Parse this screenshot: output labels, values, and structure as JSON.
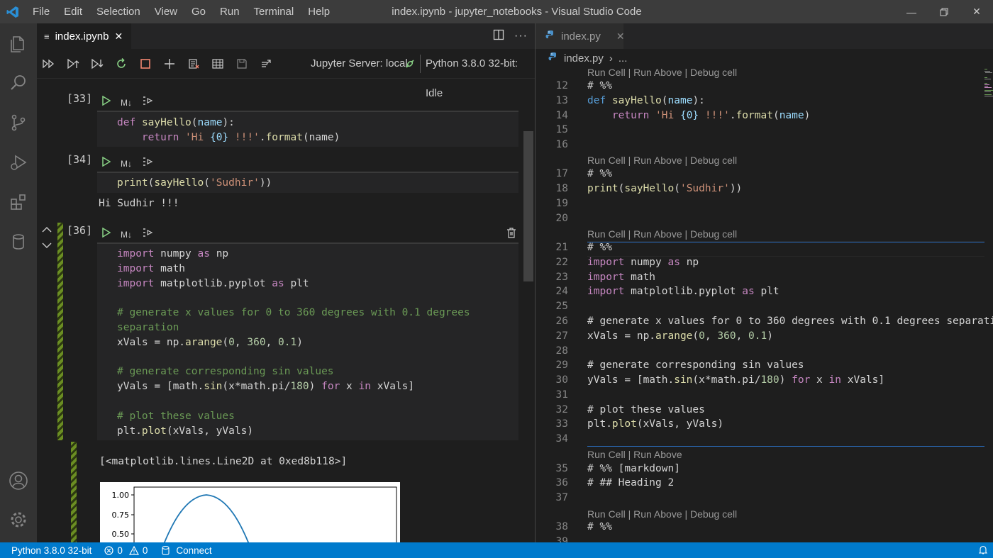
{
  "window": {
    "title": "index.ipynb - jupyter_notebooks - Visual Studio Code",
    "menu": [
      "File",
      "Edit",
      "Selection",
      "View",
      "Go",
      "Run",
      "Terminal",
      "Help"
    ]
  },
  "left_editor": {
    "tab_label": "index.ipynb",
    "jupyter_server": "Jupyter Server: local",
    "kernel": "Python 3.8.0 32-bit: Idle",
    "cell_toolbar_md": "M↓",
    "cells": [
      {
        "prompt": "[33]",
        "code": [
          "def sayHello(name):",
          "    return 'Hi {0} !!!'.format(name)"
        ]
      },
      {
        "prompt": "[34]",
        "code": [
          "print(sayHello('Sudhir'))"
        ],
        "output": "Hi Sudhir !!!"
      },
      {
        "prompt": "[36]",
        "code": [
          "import numpy as np",
          "import math",
          "import matplotlib.pyplot as plt",
          "",
          "# generate x values for 0 to 360 degrees with 0.1 degrees",
          "separation",
          "xVals = np.arange(0, 360, 0.1)",
          "",
          "# generate corresponding sin values",
          "yVals = [math.sin(x*math.pi/180) for x in xVals]",
          "",
          "# plot these values",
          "plt.plot(xVals, yVals)"
        ],
        "output": "[<matplotlib.lines.Line2D at 0xed8b118>]"
      }
    ],
    "plot": {
      "yticks": [
        "1.00",
        "0.75",
        "0.50"
      ],
      "line_color": "#1f77b4"
    }
  },
  "right_editor": {
    "tab_label": "index.py",
    "breadcrumb_file": "index.py",
    "breadcrumb_more": "...",
    "lines": [
      {
        "n": "12",
        "t": "# %%"
      },
      {
        "n": "13",
        "t": "def sayHello(name):"
      },
      {
        "n": "14",
        "t": "    return 'Hi {0} !!!'.format(name)"
      },
      {
        "n": "15",
        "t": ""
      },
      {
        "n": "16",
        "t": ""
      },
      {
        "n": "17",
        "t": "# %%"
      },
      {
        "n": "18",
        "t": "print(sayHello('Sudhir'))"
      },
      {
        "n": "19",
        "t": ""
      },
      {
        "n": "20",
        "t": ""
      },
      {
        "n": "21",
        "t": "# %%"
      },
      {
        "n": "22",
        "t": "import numpy as np"
      },
      {
        "n": "23",
        "t": "import math"
      },
      {
        "n": "24",
        "t": "import matplotlib.pyplot as plt"
      },
      {
        "n": "25",
        "t": ""
      },
      {
        "n": "26",
        "t": "# generate x values for 0 to 360 degrees with 0.1 degrees separati"
      },
      {
        "n": "27",
        "t": "xVals = np.arange(0, 360, 0.1)"
      },
      {
        "n": "28",
        "t": ""
      },
      {
        "n": "29",
        "t": "# generate corresponding sin values"
      },
      {
        "n": "30",
        "t": "yVals = [math.sin(x*math.pi/180) for x in xVals]"
      },
      {
        "n": "31",
        "t": ""
      },
      {
        "n": "32",
        "t": "# plot these values"
      },
      {
        "n": "33",
        "t": "plt.plot(xVals, yVals)"
      },
      {
        "n": "34",
        "t": ""
      },
      {
        "n": "35",
        "t": "# %% [markdown]"
      },
      {
        "n": "36",
        "t": "# ## Heading 2"
      },
      {
        "n": "37",
        "t": ""
      },
      {
        "n": "38",
        "t": "# %%"
      },
      {
        "n": "39",
        "t": ""
      }
    ],
    "code_lens_full": "Run Cell | Run Above | Debug cell",
    "code_lens_short": "Run Cell | Run Above"
  },
  "statusbar": {
    "interpreter": "Python 3.8.0 32-bit",
    "errors": "0",
    "warnings": "0",
    "connect": "Connect"
  }
}
